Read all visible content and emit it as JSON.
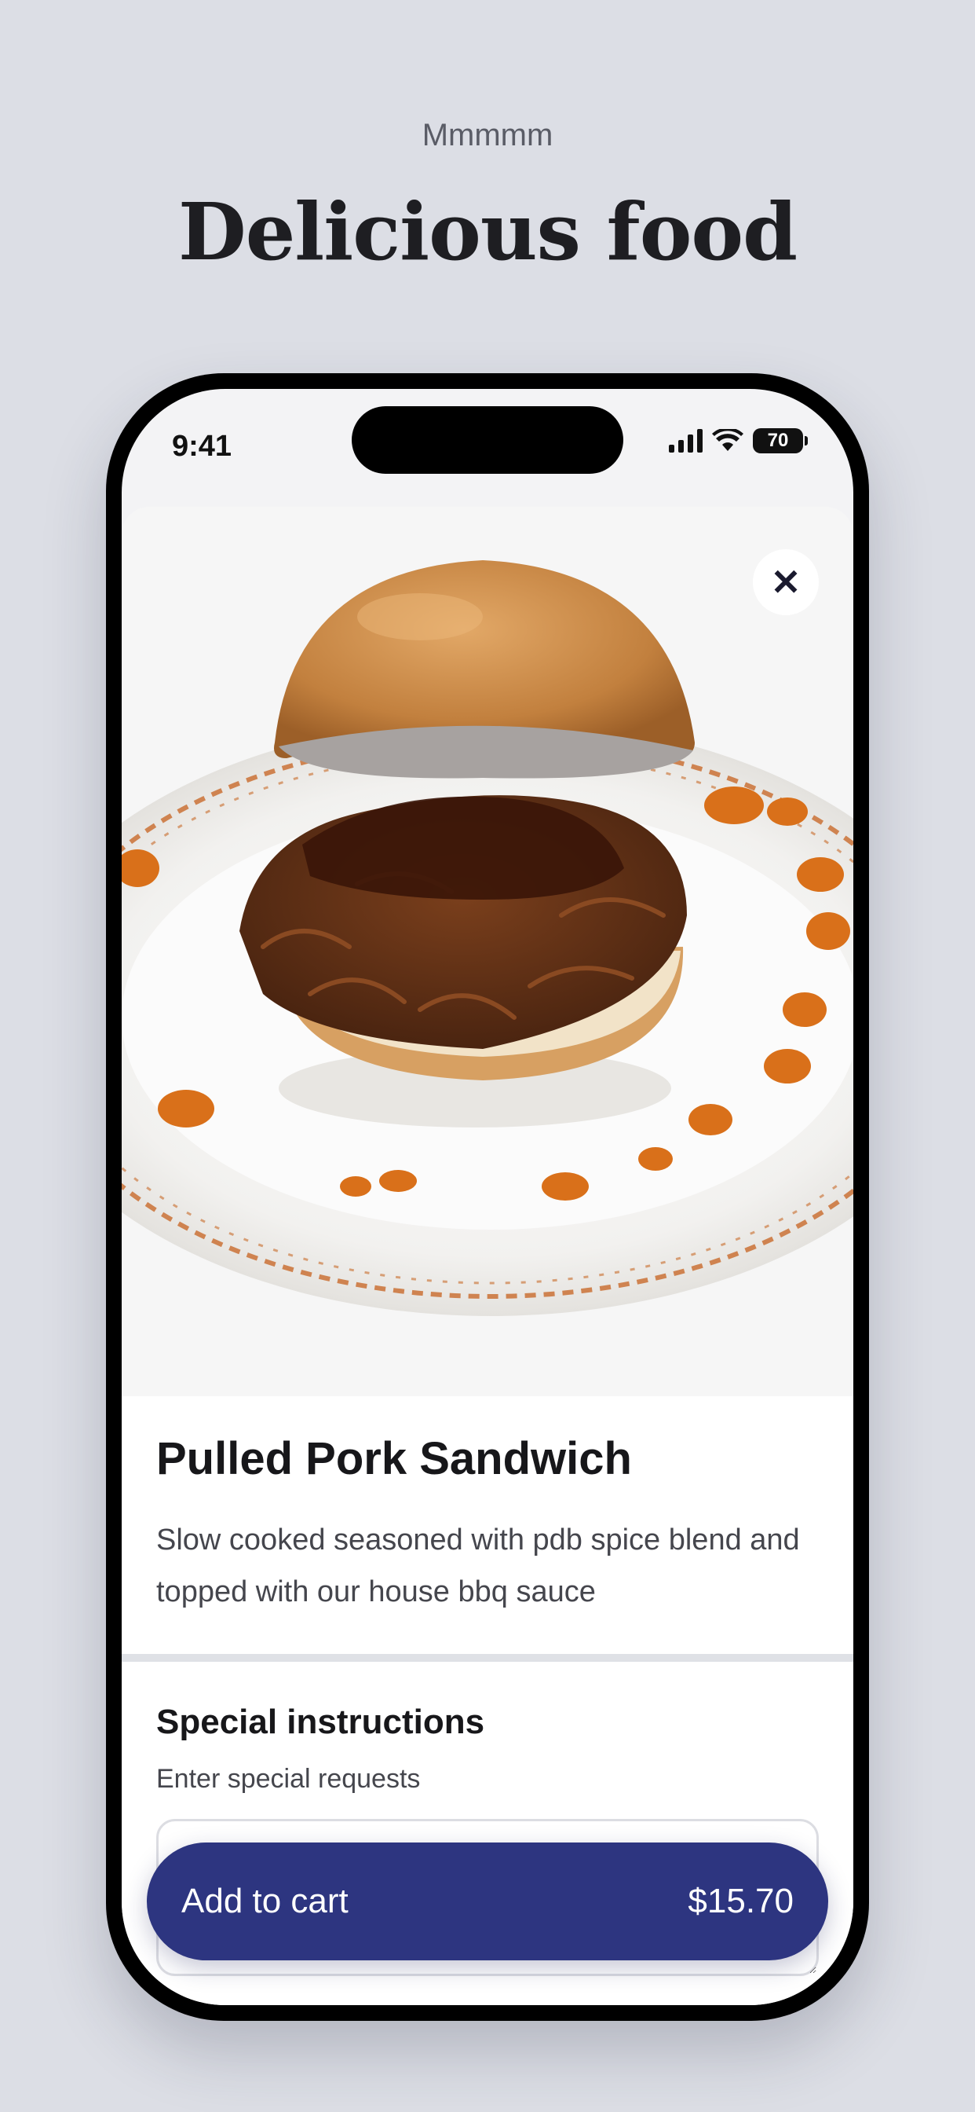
{
  "promo": {
    "kicker": "Mmmmm",
    "title": "Delicious food"
  },
  "status_bar": {
    "time": "9:41",
    "battery": "70",
    "icons": [
      "cellular-signal-icon",
      "wifi-icon",
      "battery-icon"
    ]
  },
  "product": {
    "image": "pulled-pork-sandwich-photo",
    "name": "Pulled Pork Sandwich",
    "description": "Slow cooked seasoned with pdb spice blend and topped with our house bbq sauce"
  },
  "close_button": {
    "icon": "close-icon",
    "symbol": "✕"
  },
  "special_instructions": {
    "title": "Special instructions",
    "subtitle": "Enter special requests",
    "value": ""
  },
  "cart_button": {
    "label": "Add to cart",
    "price": "$15.70"
  },
  "colors": {
    "background": "#dcdee5",
    "accent": "#2d3580",
    "sauce": "#c95f12",
    "bun": "#c98a4a"
  }
}
